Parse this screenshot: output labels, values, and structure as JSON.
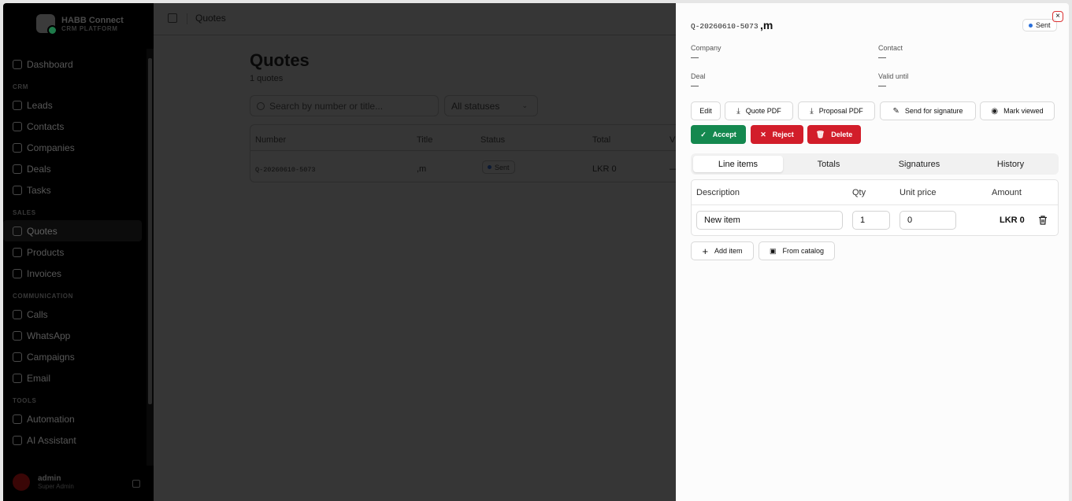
{
  "sidebar": {
    "brand_name": "HABB Connect",
    "brand_sub": "CRM PLATFORM",
    "dashboard": "Dashboard",
    "sections": {
      "crm": "CRM",
      "sales": "SALES",
      "communication": "COMMUNICATION",
      "tools": "TOOLS"
    },
    "crm_items": [
      "Leads",
      "Contacts",
      "Companies",
      "Deals",
      "Tasks"
    ],
    "sales_items": [
      "Quotes",
      "Products",
      "Invoices"
    ],
    "comm_items": [
      "Calls",
      "WhatsApp",
      "Campaigns",
      "Email"
    ],
    "tools_items": [
      "Automation",
      "AI Assistant"
    ],
    "user_name": "admin",
    "user_role": "Super Admin"
  },
  "main": {
    "breadcrumb": "Quotes",
    "title": "Quotes",
    "count": "1 quotes",
    "search_placeholder": "Search by number or title...",
    "status_filter": "All statuses",
    "columns": [
      "Number",
      "Title",
      "Status",
      "Total",
      "V"
    ],
    "row": {
      "number": "Q-20260610-5073",
      "title": ",m",
      "status": "Sent",
      "total": "LKR 0",
      "valid": "—"
    }
  },
  "drawer": {
    "number": "Q-20260610-5073",
    "title": ",m",
    "status": "Sent",
    "close": "×",
    "company_label": "Company",
    "company_value": "—",
    "contact_label": "Contact",
    "contact_value": "—",
    "deal_label": "Deal",
    "deal_value": "—",
    "valid_label": "Valid until",
    "valid_value": "—",
    "actions": {
      "edit": "Edit",
      "quote_pdf": "Quote PDF",
      "proposal_pdf": "Proposal PDF",
      "send_signature": "Send for signature",
      "mark_viewed": "Mark viewed",
      "accept": "Accept",
      "reject": "Reject",
      "delete": "Delete"
    },
    "tabs": [
      "Line items",
      "Totals",
      "Signatures",
      "History"
    ],
    "active_tab": "Line items",
    "line_columns": [
      "Description",
      "Qty",
      "Unit price",
      "Amount"
    ],
    "line_item": {
      "description": "New item",
      "qty": "1",
      "unit_price": "0",
      "amount": "LKR 0"
    },
    "add_item": "Add item",
    "from_catalog": "From catalog"
  },
  "colors": {
    "accept": "#14884f",
    "reject": "#d21d2a",
    "status_dot": "#2a6fdb"
  }
}
